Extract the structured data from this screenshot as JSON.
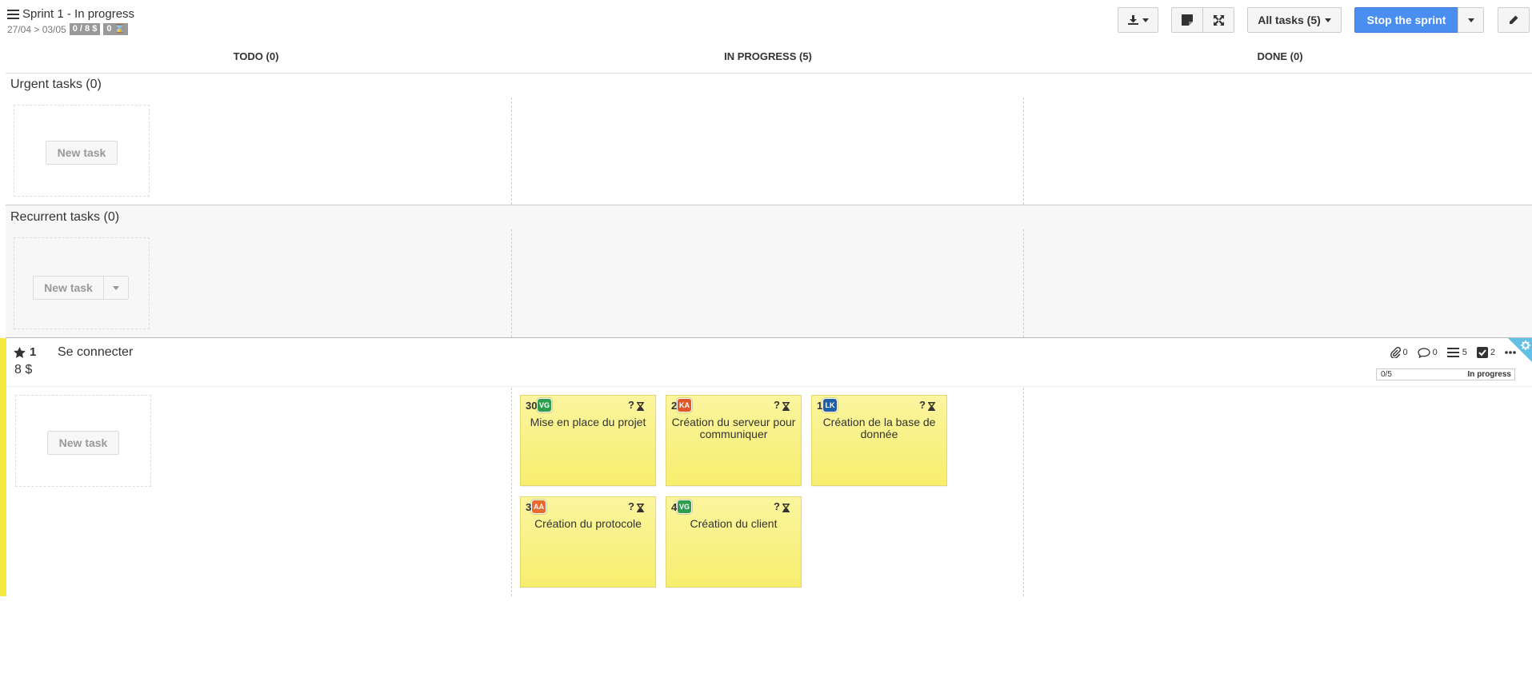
{
  "sprint": {
    "title": "Sprint 1 - In progress",
    "dates": "27/04 > 03/05",
    "points_badge": "0 / 8 $",
    "time_badge": "0 ⌛"
  },
  "toolbar": {
    "all_tasks": "All tasks (5)",
    "stop_sprint": "Stop the sprint"
  },
  "columns": [
    "TODO (0)",
    "IN PROGRESS (5)",
    "DONE (0)"
  ],
  "lanes": {
    "urgent": {
      "title": "Urgent tasks (0)",
      "new_task": "New task"
    },
    "recurrent": {
      "title": "Recurrent tasks (0)",
      "new_task": "New task"
    }
  },
  "story": {
    "rank": "1",
    "title": "Se connecter",
    "value": "8 $",
    "attachments": "0",
    "comments": "0",
    "tasks": "5",
    "acceptance": "2",
    "progress_left": "0/5",
    "progress_state": "In progress",
    "new_task": "New task",
    "color": "#f5ea3f"
  },
  "cards": [
    {
      "id": "30",
      "initials": "VG",
      "avatar_color": "#2e9d4e",
      "estimate": "?",
      "text": "Mise en place du projet"
    },
    {
      "id": "2",
      "initials": "KA",
      "avatar_color": "#e0572a",
      "estimate": "?",
      "text": "Création du serveur pour communiquer"
    },
    {
      "id": "1",
      "initials": "LK",
      "avatar_color": "#1f5fa8",
      "estimate": "?",
      "text": "Création de la base de donnée"
    },
    {
      "id": "3",
      "initials": "AA",
      "avatar_color": "#e86a2c",
      "estimate": "?",
      "text": "Création du protocole"
    },
    {
      "id": "4",
      "initials": "VG",
      "avatar_color": "#2e9d4e",
      "estimate": "?",
      "text": "Création du client"
    }
  ]
}
